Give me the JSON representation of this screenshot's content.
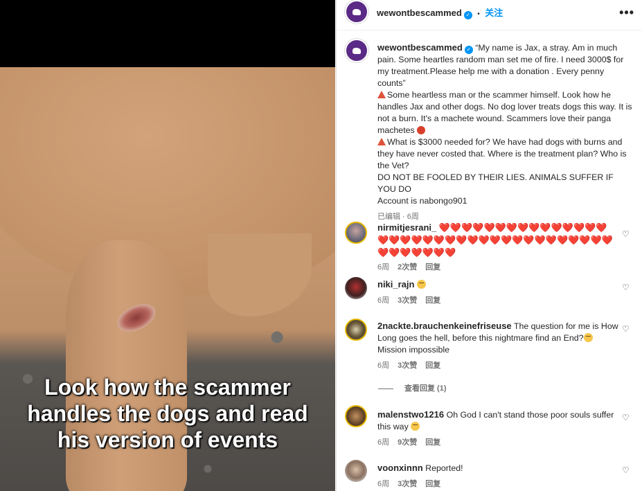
{
  "media": {
    "caption_lines": [
      "Look how the scammer",
      "handles the dogs and read",
      "his version of events"
    ]
  },
  "header": {
    "username": "wewontbescammed",
    "separator": "•",
    "follow_label": "关注",
    "more_icon": "ellipsis-icon"
  },
  "post": {
    "username": "wewontbescammed",
    "caption_para1": "“My name is Jax, a stray. Am in much pain. Some heartles random man set me of fire. I need 3000$ for my treatment.Please help me with a donation . Every penny counts”",
    "caption_para2": "Some heartless man or the scammer himself. Look how he handles Jax and other dogs. No dog lover treats dogs this way. It is not a burn. It's a machete wound. Scammers love their panga machetes",
    "caption_para3": "What is $3000 needed for? We have had dogs with burns and they have never costed that. Where is the treatment plan? Who is the Vet?",
    "caption_para4": "DO NOT BE FOOLED BY THEIR LIES. ANIMALS SUFFER IF YOU DO",
    "caption_para5": "Account is nabongo901",
    "meta": "已编辑 · 6周"
  },
  "comments": [
    {
      "username": "nirmitjesrani_",
      "text": "❤️❤️❤️❤️❤️❤️❤️❤️❤️❤️❤️❤️❤️❤️❤️❤️❤️❤️❤️❤️❤️❤️❤️❤️❤️❤️❤️❤️❤️❤️❤️❤️❤️❤️❤️❤️❤️❤️❤️❤️❤️❤️❤️",
      "time": "6周",
      "likes": "2次赞",
      "reply": "回复"
    },
    {
      "username": "niki_rajn",
      "text": "",
      "time": "6周",
      "likes": "3次赞",
      "reply": "回复"
    },
    {
      "username": "2nackte.brauchenkeinefriseuse",
      "text": "The question for me is How Long goes the hell, before this nightmare find an End?",
      "text2": "Mission impossible",
      "time": "6周",
      "likes": "3次赞",
      "reply": "回复"
    },
    {
      "username": "malenstwo1216",
      "text": "Oh God I can't stand those poor souls suffer this way",
      "time": "6周",
      "likes": "9次赞",
      "reply": "回复"
    },
    {
      "username": "voonxinnn",
      "text": "Reported!",
      "time": "6周",
      "likes": "3次赞",
      "reply": "回复"
    }
  ],
  "view_replies": "查看回复 (1)",
  "colors": {
    "accent": "#0095f6",
    "brand": "#5b2a86",
    "heart_red": "#e0242f"
  }
}
